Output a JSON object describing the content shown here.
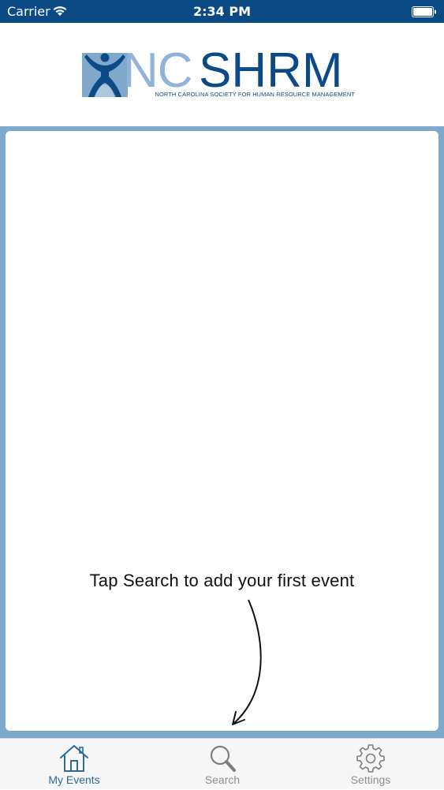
{
  "status_bar": {
    "carrier": "Carrier",
    "time": "2:34 PM"
  },
  "header": {
    "logo": {
      "nc": "NC",
      "shrm": "SHRM",
      "tagline": "NORTH CAROLINA SOCIETY FOR HUMAN RESOURCE MANAGEMENT"
    }
  },
  "main": {
    "hint": "Tap Search to add your first event"
  },
  "tab_bar": {
    "tabs": [
      {
        "label": "My Events",
        "icon": "house-icon",
        "active": true
      },
      {
        "label": "Search",
        "icon": "magnifier-icon",
        "active": false
      },
      {
        "label": "Settings",
        "icon": "gear-icon",
        "active": false
      }
    ]
  },
  "colors": {
    "status_bar": "#0b4a84",
    "brand_dark": "#0b4a84",
    "brand_light": "#8fb4d8",
    "frame": "#7fa9cb",
    "tab_active": "#2b6a99",
    "tab_inactive": "#8e8e93"
  }
}
